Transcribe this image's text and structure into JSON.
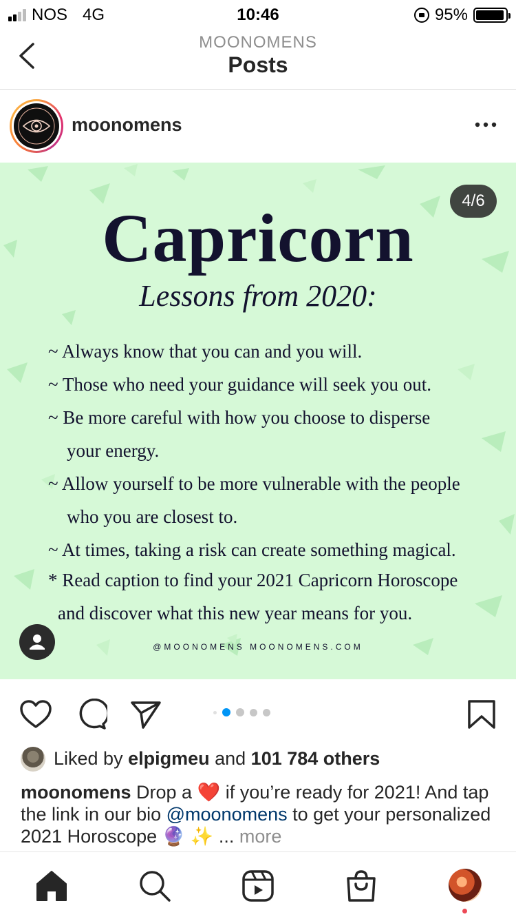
{
  "status_bar": {
    "carrier": "NOS",
    "network": "4G",
    "time": "10:46",
    "battery": "95%",
    "battery_level": 0.95
  },
  "header": {
    "account": "MOONOMENS",
    "title": "Posts"
  },
  "post": {
    "username": "moonomens",
    "image": {
      "counter": "4/6",
      "title": "Capricorn",
      "subtitle": "Lessons from 2020:",
      "lessons": [
        [
          "~ Always know that you can and you will."
        ],
        [
          "~ Those who need your guidance will seek you out."
        ],
        [
          "~ Be more careful with how you choose to disperse",
          "your energy."
        ],
        [
          "~ Allow yourself to be more vulnerable with the people",
          "who you are closest to."
        ],
        [
          "~ At times, taking a risk can create something magical."
        ]
      ],
      "note_line1": "* Read caption to find your 2021 Capricorn Horoscope",
      "note_line2": "and discover what this new year means for you.",
      "footer": "@MOONOMENS   MOONOMENS.COM"
    },
    "carousel": {
      "total": 6,
      "active": 4
    },
    "likes": {
      "prefix": "Liked by ",
      "user": "elpigmeu",
      "middle": " and ",
      "others": "101 784 others"
    },
    "caption": {
      "user": "moonomens",
      "part1": " Drop a ",
      "emoji_heart": "❤️",
      "part2": " if you’re ready for 2021! And tap the link in our bio ",
      "mention": "@moonomens",
      "part3": " to get your personalized 2021 Horoscope ",
      "emoji_end": "🔮 ✨",
      "ellipsis": " ... ",
      "more": "more"
    }
  },
  "colors": {
    "image_bg": "#d6f9d7",
    "ink": "#13122e",
    "accent_blue": "#0095f6",
    "mention": "#00376b",
    "notification": "#ed4956"
  },
  "icons": {
    "back": "chevron-left-icon",
    "more": "more-horizontal-icon",
    "like": "heart-icon",
    "comment": "comment-icon",
    "share": "send-icon",
    "save": "bookmark-icon",
    "tabs": [
      "home-icon",
      "search-icon",
      "reels-icon",
      "shop-icon",
      "profile-avatar"
    ]
  }
}
